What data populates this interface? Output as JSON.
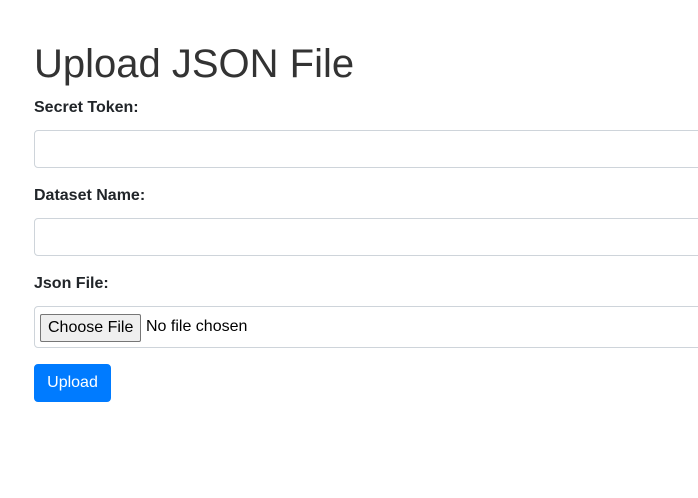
{
  "page": {
    "title": "Upload JSON File"
  },
  "form": {
    "secret_token": {
      "label": "Secret Token:",
      "value": ""
    },
    "dataset_name": {
      "label": "Dataset Name:",
      "value": ""
    },
    "json_file": {
      "label": "Json File:",
      "button_label": "Choose File",
      "status": "No file chosen"
    },
    "submit_label": "Upload"
  },
  "colors": {
    "primary": "#007bff",
    "title": "#333333",
    "border": "#ced4da"
  }
}
